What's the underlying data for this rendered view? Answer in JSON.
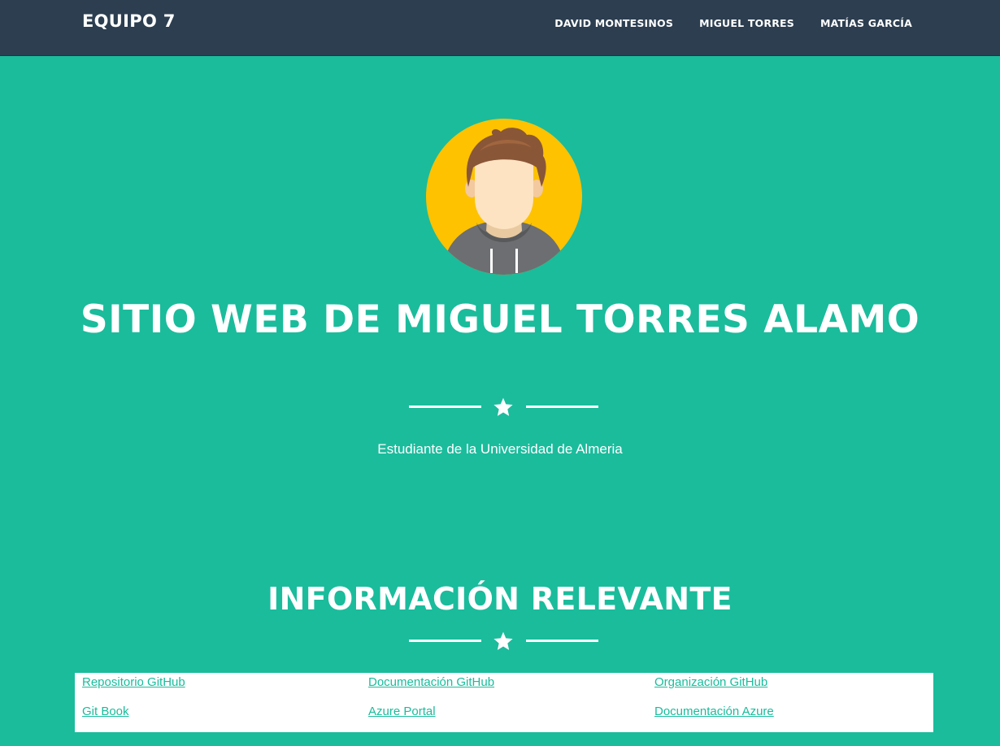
{
  "navbar": {
    "brand": "EQUIPO 7",
    "links": [
      {
        "label": "DAVID MONTESINOS"
      },
      {
        "label": "MIGUEL TORRES"
      },
      {
        "label": "MATÍAS GARCÍA"
      }
    ]
  },
  "hero": {
    "avatar_icon": "user-avatar-icon",
    "title": "SITIO WEB DE MIGUEL TORRES ALAMO",
    "divider_icon": "star-icon",
    "subtitle": "Estudiante de la Universidad de Almeria"
  },
  "info": {
    "title": "INFORMACIÓN RELEVANTE",
    "divider_icon": "star-icon",
    "links": [
      {
        "label": "Repositorio GitHub"
      },
      {
        "label": "Documentación GitHub"
      },
      {
        "label": "Organización GitHub"
      },
      {
        "label": "Git Book"
      },
      {
        "label": "Azure Portal"
      },
      {
        "label": "Documentación Azure"
      }
    ]
  },
  "colors": {
    "navbar_bg": "#2c3e50",
    "page_bg": "#1abc9c",
    "text": "#ffffff",
    "link": "#1abc9c"
  }
}
